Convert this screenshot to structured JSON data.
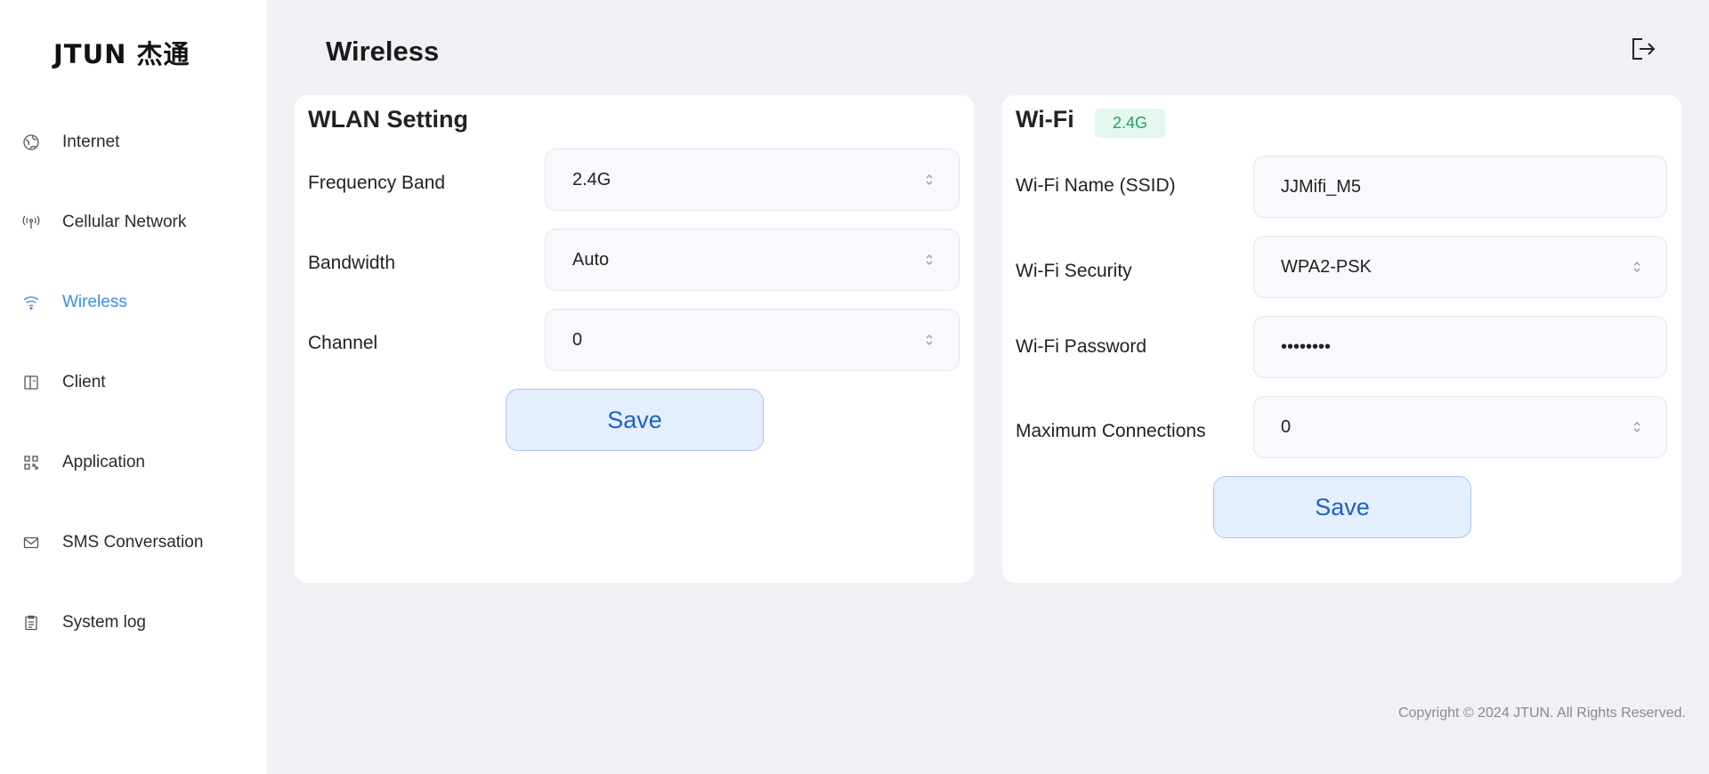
{
  "brand": {
    "logo_text": "JTUN 杰通"
  },
  "sidebar": {
    "items": [
      {
        "label": "Internet",
        "icon": "globe-icon",
        "active": false
      },
      {
        "label": "Cellular Network",
        "icon": "antenna-icon",
        "active": false
      },
      {
        "label": "Wireless",
        "icon": "wifi-icon",
        "active": true
      },
      {
        "label": "Client",
        "icon": "client-icon",
        "active": false
      },
      {
        "label": "Application",
        "icon": "grid-icon",
        "active": false
      },
      {
        "label": "SMS Conversation",
        "icon": "envelope-icon",
        "active": false
      },
      {
        "label": "System log",
        "icon": "clipboard-icon",
        "active": false
      }
    ]
  },
  "header": {
    "title": "Wireless",
    "logout_icon": "logout-icon"
  },
  "wlan": {
    "title": "WLAN Setting",
    "frequency_label": "Frequency Band",
    "frequency_value": "2.4G",
    "bandwidth_label": "Bandwidth",
    "bandwidth_value": "Auto",
    "channel_label": "Channel",
    "channel_value": "0",
    "save_label": "Save"
  },
  "wifi": {
    "title": "Wi-Fi",
    "band_tag": "2.4G",
    "ssid_label": "Wi-Fi Name (SSID)",
    "ssid_value": "JJMifi_M5",
    "security_label": "Wi-Fi Security",
    "security_value": "WPA2-PSK",
    "password_label": "Wi-Fi Password",
    "password_value": "••••••••",
    "max_conn_label": "Maximum Connections",
    "max_conn_value": "0",
    "save_label": "Save"
  },
  "footer": {
    "copyright": "Copyright © 2024 JTUN. All Rights Reserved."
  },
  "colors": {
    "accent": "#3b8ee8",
    "button_text": "#1a63c8",
    "tag_text": "#2a9a6a"
  }
}
